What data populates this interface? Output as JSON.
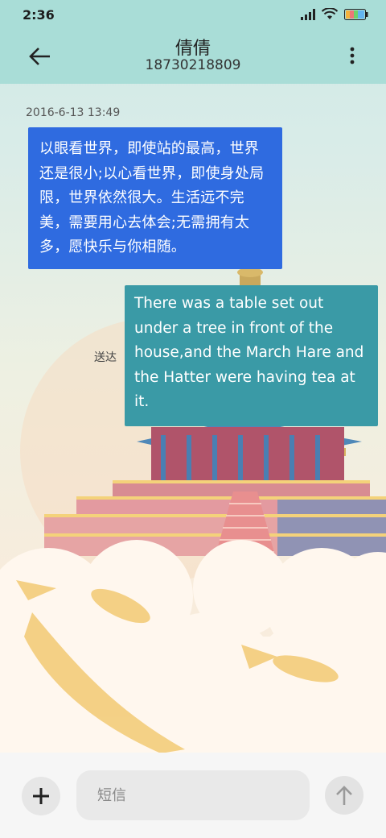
{
  "status_bar": {
    "time": "2:36",
    "icons": [
      "signal-icon",
      "wifi-icon",
      "battery-icon"
    ]
  },
  "header": {
    "title": "倩倩",
    "phone": "18730218809",
    "back_icon": "back-arrow-icon",
    "more_icon": "more-vert-icon"
  },
  "thread": {
    "timestamp": "2016-6-13 13:49",
    "messages": [
      {
        "direction": "incoming",
        "text": "以眼看世界，即使站的最高，世界还是很小;以心看世界，即使身处局限，世界依然很大。生活远不完美，需要用心去体会;无需拥有太多，愿快乐与你相随。"
      },
      {
        "direction": "outgoing",
        "text": "There was a table set out under a tree in front of the house,and the March Hare and the Hatter were having tea at it.",
        "status": "送达"
      }
    ]
  },
  "composer": {
    "placeholder": "短信",
    "value": "",
    "add_icon": "plus-icon",
    "send_icon": "arrow-up-icon"
  },
  "colors": {
    "header_bg": "#a9ddd7",
    "incoming_bubble": "#2f6be0",
    "outgoing_bubble": "#3a9aa6"
  }
}
